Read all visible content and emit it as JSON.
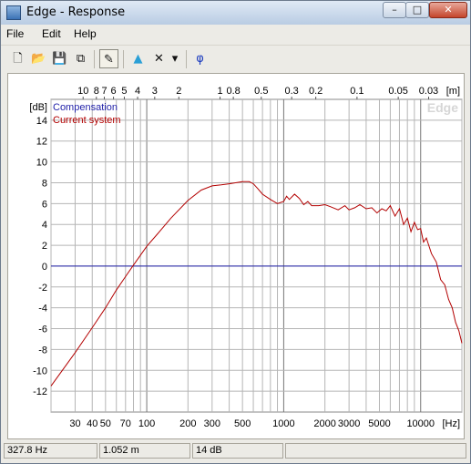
{
  "window": {
    "title": "Edge - Response",
    "buttons": {
      "minimize": "–",
      "maximize": "□",
      "close": "✕"
    }
  },
  "menu": [
    {
      "label": "File"
    },
    {
      "label": "Edit"
    },
    {
      "label": "Help"
    }
  ],
  "toolbar": {
    "items": [
      {
        "name": "new-icon",
        "glyph": "🗋"
      },
      {
        "name": "open-icon",
        "glyph": "📂"
      },
      {
        "name": "save-icon",
        "glyph": "💾"
      },
      {
        "name": "copy-icon",
        "glyph": "⧉"
      },
      {
        "name": "pencil-icon",
        "glyph": "✎"
      },
      {
        "name": "speaker-icon",
        "glyph": "▲"
      },
      {
        "name": "delete-icon",
        "glyph": "✕"
      },
      {
        "name": "dropdown-arrow-icon",
        "glyph": "▾"
      },
      {
        "name": "phase-icon",
        "glyph": "φ"
      }
    ]
  },
  "legend": [
    {
      "label": "Compensation",
      "color": "#1f1fa8"
    },
    {
      "label": "Current system",
      "color": "#b30000"
    }
  ],
  "watermark": "Edge",
  "chart_data": {
    "type": "line",
    "x_axis": {
      "label": "[Hz]",
      "scale": "log",
      "range": [
        20,
        20000
      ],
      "ticks": [
        30,
        40,
        50,
        70,
        100,
        200,
        300,
        500,
        1000,
        2000,
        3000,
        5000,
        10000
      ],
      "tick_labels": [
        "30",
        "40",
        "50",
        "70",
        "100",
        "200",
        "300",
        "500",
        "1000",
        "2000",
        "3000",
        "5000",
        "10000"
      ]
    },
    "top_axis": {
      "label": "[m]",
      "ticks": [
        10,
        8,
        7,
        6,
        5,
        4,
        3,
        2,
        1,
        0.8,
        0.5,
        0.3,
        0.2,
        0.1,
        0.05,
        0.03
      ],
      "tick_labels": [
        "10",
        "8",
        "7",
        "6",
        "5",
        "4",
        "3",
        "2",
        "1",
        "0.8",
        "0.5",
        "0.3",
        "0.2",
        "0.1",
        "0.05",
        "0.03"
      ]
    },
    "y_axis": {
      "label": "[dB]",
      "range": [
        -14,
        16
      ],
      "ticks": [
        14,
        12,
        10,
        8,
        6,
        4,
        2,
        0,
        -2,
        -4,
        -6,
        -8,
        -10,
        -12
      ],
      "tick_labels": [
        "14",
        "12",
        "10",
        "8",
        "6",
        "4",
        "2",
        "0",
        "-2",
        "-4",
        "-6",
        "-8",
        "-10",
        "-12"
      ]
    },
    "grid": true,
    "series": [
      {
        "name": "Compensation",
        "color": "#1f1fa8",
        "x": [
          20,
          20000
        ],
        "y": [
          0,
          0
        ]
      },
      {
        "name": "Current system",
        "color": "#b30000",
        "x": [
          20,
          30,
          40,
          50,
          60,
          70,
          80,
          100,
          120,
          150,
          200,
          250,
          300,
          350,
          400,
          500,
          560,
          600,
          650,
          700,
          800,
          900,
          1000,
          1050,
          1100,
          1200,
          1300,
          1400,
          1500,
          1600,
          1800,
          2000,
          2200,
          2500,
          2800,
          3000,
          3300,
          3600,
          4000,
          4400,
          4800,
          5200,
          5600,
          6000,
          6500,
          7000,
          7500,
          8000,
          8500,
          9000,
          9500,
          10000,
          10500,
          11000,
          12000,
          13000,
          14000,
          15000,
          16000,
          17000,
          18000,
          19000,
          20000
        ],
        "y": [
          -11.5,
          -8.3,
          -5.9,
          -4.0,
          -2.3,
          -1.0,
          0.1,
          1.9,
          3.1,
          4.6,
          6.3,
          7.3,
          7.7,
          7.8,
          7.9,
          8.1,
          8.1,
          7.9,
          7.4,
          6.9,
          6.4,
          6.0,
          6.2,
          6.7,
          6.4,
          6.9,
          6.5,
          5.9,
          6.2,
          5.8,
          5.8,
          5.9,
          5.7,
          5.4,
          5.8,
          5.4,
          5.6,
          5.9,
          5.5,
          5.6,
          5.1,
          5.5,
          5.3,
          5.8,
          4.8,
          5.5,
          4.0,
          4.6,
          3.3,
          4.2,
          3.5,
          3.6,
          2.3,
          2.7,
          1.2,
          0.4,
          -1.3,
          -1.8,
          -3.2,
          -4.0,
          -5.4,
          -6.2,
          -7.4
        ]
      }
    ]
  },
  "status": {
    "frequency": "327.8 Hz",
    "distance": "1.052 m",
    "level": "14 dB"
  }
}
